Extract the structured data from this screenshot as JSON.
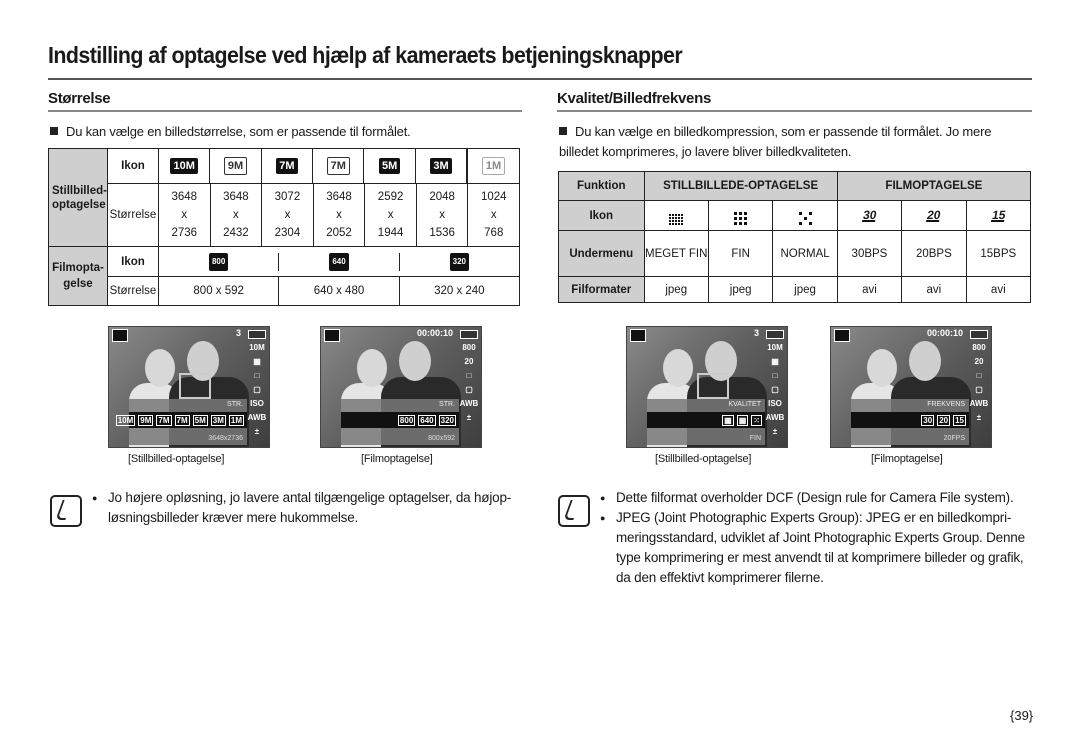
{
  "page": {
    "title": "Indstilling af optagelse ved hjælp af kameraets betjeningsknapper",
    "page_number": "{39}"
  },
  "left": {
    "section_title": "Størrelse",
    "intro": "Du kan vælge en billedstørrelse, som er passende til formålet.",
    "table": {
      "still_label": "Stillbilled-optagelse",
      "movie_label": "Filmopta-gelse",
      "icon_label": "Ikon",
      "size_label": "Størrelse",
      "still_icons": [
        "10M",
        "9M",
        "7M",
        "7M",
        "5M",
        "3M",
        "1M"
      ],
      "still_sizes": [
        {
          "w": "3648",
          "x": "x",
          "h": "2736"
        },
        {
          "w": "3648",
          "x": "x",
          "h": "2432"
        },
        {
          "w": "3072",
          "x": "x",
          "h": "2304"
        },
        {
          "w": "3648",
          "x": "x",
          "h": "2052"
        },
        {
          "w": "2592",
          "x": "x",
          "h": "1944"
        },
        {
          "w": "2048",
          "x": "x",
          "h": "1536"
        },
        {
          "w": "1024",
          "x": "x",
          "h": "768"
        }
      ],
      "movie_icons": [
        "800",
        "640",
        "320"
      ],
      "movie_sizes": [
        "800 x 592",
        "640 x 480",
        "320 x 240"
      ]
    },
    "screens": [
      {
        "caption": "[Stillbilled-optagelse]",
        "count": "3",
        "panel_label": "STR.",
        "panel_value": "3648x2736",
        "strip": [
          "10M",
          "9M",
          "7M",
          "7M",
          "5M",
          "3M",
          "1M"
        ],
        "side": [
          "10M",
          "▦",
          "□",
          "▢",
          "ISO",
          "AWB",
          "±"
        ]
      },
      {
        "caption": "[Filmoptagelse]",
        "count": "00:00:10",
        "panel_label": "STR.",
        "panel_value": "800x592",
        "strip": [
          "800",
          "640",
          "320"
        ],
        "side": [
          "800",
          "20",
          "□",
          "▢",
          "AWB",
          "±"
        ]
      }
    ],
    "note": [
      "Jo højere opløsning, jo lavere antal tilgængelige optagelser, da højop-løsningsbilleder kræver mere hukommelse."
    ]
  },
  "right": {
    "section_title": "Kvalitet/Billedfrekvens",
    "intro": "Du kan vælge en billedkompression, som er passende til formålet.  Jo mere billedet komprimeres, jo lavere bliver billedkvaliteten.",
    "table": {
      "function_label": "Funktion",
      "still_header": "STILLBILLEDE-OPTAGELSE",
      "movie_header": "FILMOPTAGELSE",
      "icon_label": "Ikon",
      "submenu_label": "Undermenu",
      "format_label": "Filformater",
      "icons": [
        "super-fine-icon",
        "fine-icon",
        "normal-icon",
        "30fps-icon",
        "20fps-icon",
        "15fps-icon"
      ],
      "fps_icon_text": [
        "30",
        "20",
        "15"
      ],
      "submenus": [
        "MEGET FIN",
        "FIN",
        "NORMAL",
        "30BPS",
        "20BPS",
        "15BPS"
      ],
      "formats": [
        "jpeg",
        "jpeg",
        "jpeg",
        "avi",
        "avi",
        "avi"
      ]
    },
    "screens": [
      {
        "caption": "[Stillbilled-optagelse]",
        "count": "3",
        "panel_label": "KVALITET",
        "panel_value": "FIN",
        "strip": [
          "▦",
          "▦",
          "⁙"
        ],
        "side": [
          "10M",
          "▦",
          "□",
          "▢",
          "ISO",
          "AWB",
          "±"
        ]
      },
      {
        "caption": "[Filmoptagelse]",
        "count": "00:00:10",
        "panel_label": "FREKVENS",
        "panel_value": "20FPS",
        "strip": [
          "30",
          "20",
          "15"
        ],
        "side": [
          "800",
          "20",
          "□",
          "▢",
          "AWB",
          "±"
        ]
      }
    ],
    "note": [
      "Dette filformat overholder DCF (Design rule for Camera File system).",
      "JPEG (Joint Photographic Experts Group):  JPEG er en billedkompri-meringsstandard, udviklet af Joint Photographic Experts Group.  Denne type komprimering er mest anvendt til at komprimere billeder og grafik, da den effektivt komprimerer filerne."
    ]
  }
}
